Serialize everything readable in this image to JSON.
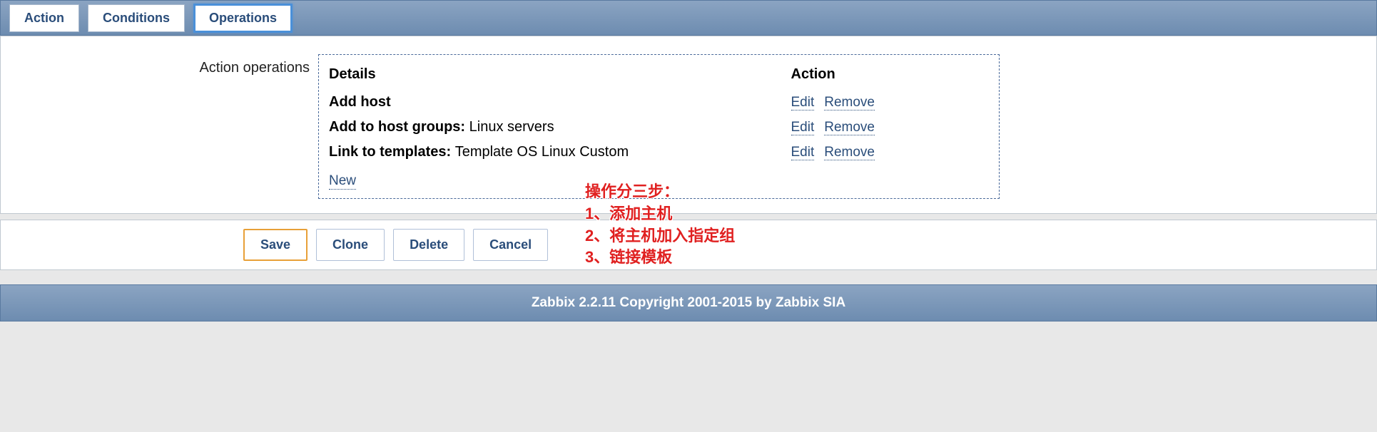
{
  "tabs": {
    "action": "Action",
    "conditions": "Conditions",
    "operations": "Operations"
  },
  "form": {
    "label": "Action operations",
    "headers": {
      "details": "Details",
      "action": "Action"
    },
    "rows": [
      {
        "label": "Add host",
        "value": ""
      },
      {
        "label": "Add to host groups: ",
        "value": "Linux servers"
      },
      {
        "label": "Link to templates: ",
        "value": "Template OS Linux Custom"
      }
    ],
    "edit": "Edit",
    "remove": "Remove",
    "new": "New"
  },
  "buttons": {
    "save": "Save",
    "clone": "Clone",
    "delete": "Delete",
    "cancel": "Cancel"
  },
  "footer": "Zabbix 2.2.11 Copyright 2001-2015 by Zabbix SIA",
  "annotation": {
    "l0": "操作分三步：",
    "l1": "1、添加主机",
    "l2": "2、将主机加入指定组",
    "l3": "3、链接模板"
  }
}
